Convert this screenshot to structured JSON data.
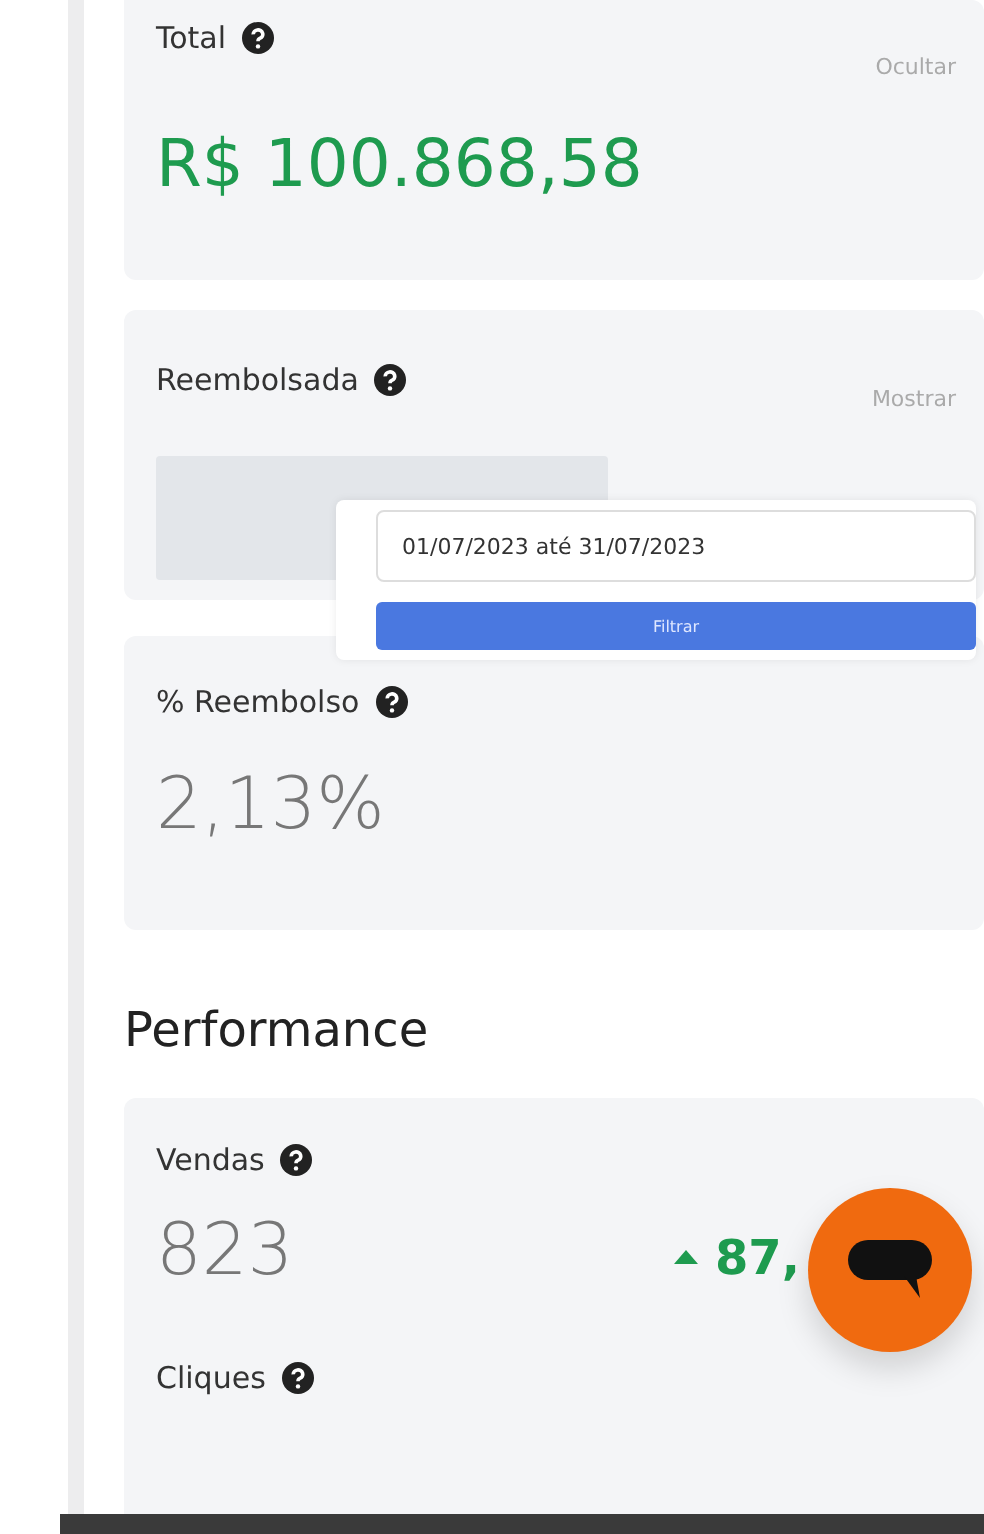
{
  "total_card": {
    "label": "Total",
    "toggle": "Ocultar",
    "value": "R$ 100.868,58",
    "hidden": false
  },
  "refund_card": {
    "label": "Reembolsada",
    "toggle": "Mostrar",
    "hidden": true
  },
  "date_filter": {
    "value": "01/07/2023 até 31/07/2023",
    "button": "Filtrar"
  },
  "refund_rate_card": {
    "label": "% Reembolso",
    "value": "2,13%"
  },
  "section_title": "Performance",
  "sales_card": {
    "label": "Vendas",
    "value": "823",
    "trend": {
      "rising": true,
      "value": "87,"
    }
  },
  "clicks_card": {
    "label": "Cliques"
  }
}
